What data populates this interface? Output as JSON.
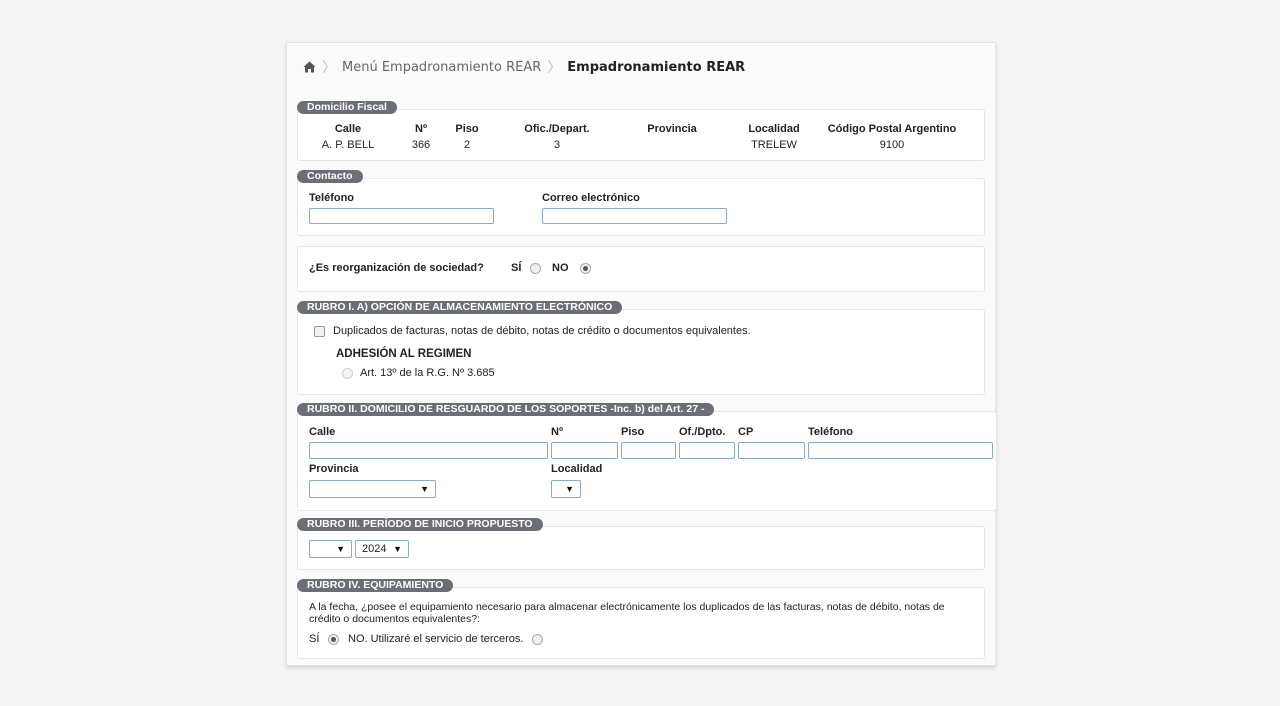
{
  "breadcrumb": {
    "home_icon": "home-icon",
    "items": [
      "Menú Empadronamiento REAR",
      "Empadronamiento REAR"
    ]
  },
  "domicilio_fiscal": {
    "legend": "Domicilio Fiscal",
    "headers": [
      "Calle",
      "Nº",
      "Piso",
      "Ofic./Depart.",
      "Provincia",
      "Localidad",
      "Código Postal Argentino"
    ],
    "values": [
      "A. P. BELL",
      "366",
      "2",
      "3",
      "",
      "TRELEW",
      "9100"
    ]
  },
  "contacto": {
    "legend": "Contacto",
    "telefono_label": "Teléfono",
    "telefono_value": "",
    "correo_label": "Correo electrónico",
    "correo_value": ""
  },
  "reorganizacion": {
    "question": "¿Es reorganización de sociedad?",
    "si_label": "SÍ",
    "no_label": "NO",
    "selected": "NO"
  },
  "rubro1": {
    "legend": "RUBRO I. A) OPCIÓN DE ALMACENAMIENTO ELECTRÓNICO",
    "checkbox_label": "Duplicados de facturas, notas de débito, notas de crédito o documentos equivalentes.",
    "checked": false,
    "adhesion_title": "ADHESIÓN AL REGIMEN",
    "adhesion_option": "Art. 13º de la R.G. Nº 3.685"
  },
  "rubro2": {
    "legend": "RUBRO II. DOMICILIO DE RESGUARDO DE LOS SOPORTES -Inc. b) del Art. 27 -",
    "calle_label": "Calle",
    "numero_label": "Nº",
    "piso_label": "Piso",
    "ofdpto_label": "Of./Dpto.",
    "cp_label": "CP",
    "telefono_label": "Teléfono",
    "provincia_label": "Provincia",
    "provincia_value": "",
    "localidad_label": "Localidad",
    "localidad_value": ""
  },
  "rubro3": {
    "legend": "RUBRO III. PERÍODO DE INICIO PROPUESTO",
    "month_value": "",
    "year_value": "2024"
  },
  "rubro4": {
    "legend": "RUBRO IV. EQUIPAMIENTO",
    "question_line1": "A la fecha, ¿posee el equipamiento necesario para almacenar electrónicamente los duplicados de las facturas, notas de débito, notas de",
    "question_line2": "crédito o documentos equivalentes?:",
    "si_label": "SÍ",
    "no_label": "NO. Utilizaré el servicio de terceros.",
    "selected": "SÍ"
  },
  "select_arrow": "▼"
}
